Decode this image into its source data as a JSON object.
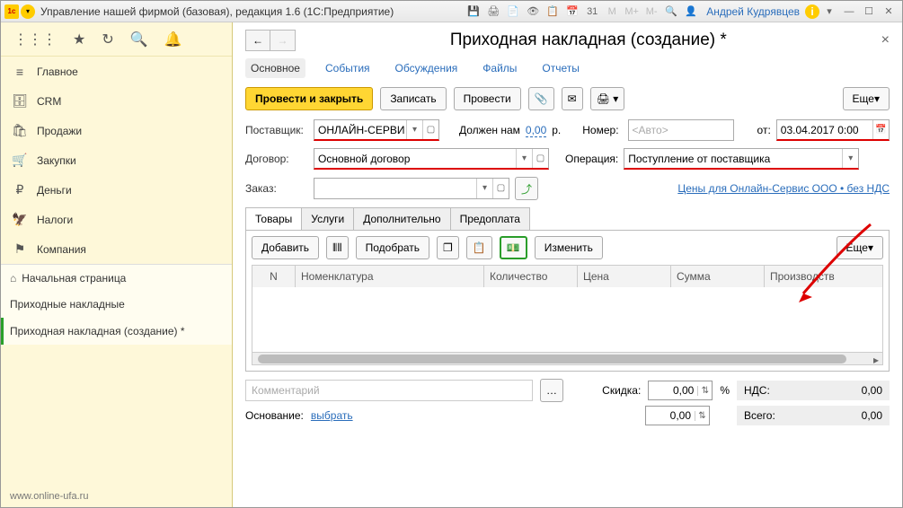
{
  "titlebar": {
    "title": "Управление нашей фирмой (базовая), редакция 1.6  (1С:Предприятие)",
    "user": "Андрей Кудрявцев",
    "m": "M",
    "mp": "M+",
    "mm": "M-"
  },
  "sidebar": {
    "items": [
      {
        "icon": "≡",
        "label": "Главное"
      },
      {
        "icon": "🗄",
        "label": "CRM"
      },
      {
        "icon": "🛍",
        "label": "Продажи"
      },
      {
        "icon": "🛒",
        "label": "Закупки"
      },
      {
        "icon": "₽",
        "label": "Деньги"
      },
      {
        "icon": "🦅",
        "label": "Налоги"
      },
      {
        "icon": "⚑",
        "label": "Компания"
      }
    ],
    "home": "Начальная страница",
    "sub1": "Приходные накладные",
    "sub2": "Приходная накладная (создание) *",
    "footer": "www.online-ufa.ru"
  },
  "header": {
    "title": "Приходная накладная (создание) *"
  },
  "tabs1": [
    "Основное",
    "События",
    "Обсуждения",
    "Файлы",
    "Отчеты"
  ],
  "cmd": {
    "post_close": "Провести и закрыть",
    "write": "Записать",
    "post": "Провести",
    "more": "Еще"
  },
  "fields": {
    "supplier_lbl": "Поставщик:",
    "supplier_val": "ОНЛАЙН-СЕРВИ",
    "owes": "Должен нам",
    "owes_val": "0,00",
    "owes_cur": "р.",
    "number_lbl": "Номер:",
    "number_ph": "<Авто>",
    "from_lbl": "от:",
    "date_val": "03.04.2017  0:00",
    "contract_lbl": "Договор:",
    "contract_val": "Основной договор",
    "operation_lbl": "Операция:",
    "operation_val": "Поступление от поставщика",
    "order_lbl": "Заказ:",
    "prices_link": "Цены для Онлайн-Сервис ООО • без НДС"
  },
  "tabs2": [
    "Товары",
    "Услуги",
    "Дополнительно",
    "Предоплата"
  ],
  "tblcmd": {
    "add": "Добавить",
    "select": "Подобрать",
    "change": "Изменить",
    "more": "Еще"
  },
  "grid": {
    "cols": [
      "N",
      "Номенклатура",
      "Количество",
      "Цена",
      "Сумма",
      "Производств"
    ]
  },
  "footer": {
    "comment_ph": "Комментарий",
    "discount_lbl": "Скидка:",
    "pct": "%",
    "basis_lbl": "Основание:",
    "basis_link": "выбрать",
    "vat_lbl": "НДС:",
    "vat_val": "0,00",
    "total_lbl": "Всего:",
    "total_val": "0,00",
    "zero": "0,00"
  }
}
